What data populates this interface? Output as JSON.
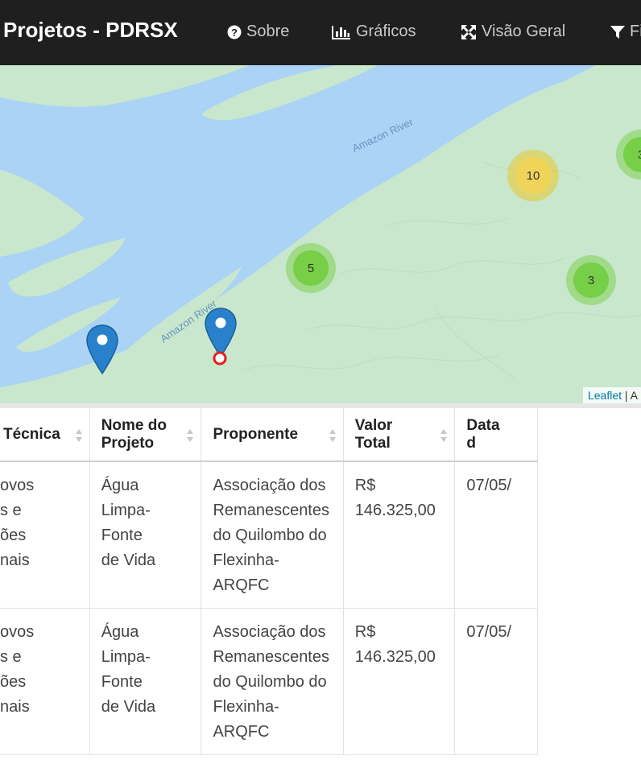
{
  "navbar": {
    "brand": "Projetos - PDRSX",
    "items": [
      {
        "label": "Sobre",
        "icon": "question-circle-icon"
      },
      {
        "label": "Gráficos",
        "icon": "bar-chart-icon"
      },
      {
        "label": "Visão Geral",
        "icon": "expand-arrows-icon"
      },
      {
        "label": "Fi",
        "icon": "filter-icon"
      }
    ]
  },
  "map": {
    "river_labels": [
      "Amazon River",
      "Amazon River"
    ],
    "clusters": [
      {
        "count": "10",
        "color": "yellow"
      },
      {
        "count": "5",
        "color": "green"
      },
      {
        "count": "3",
        "color": "green"
      },
      {
        "count": "3",
        "color": "green"
      }
    ],
    "attribution": {
      "link": "Leaflet",
      "rest": " | A"
    }
  },
  "table": {
    "columns": [
      "Técnica",
      "Nome do Projeto",
      "Proponente",
      "Valor Total",
      "Data d"
    ],
    "rows": [
      {
        "c0": [
          "ovos",
          "s e",
          "ões",
          "nais"
        ],
        "c1": [
          "Água Limpa- Fonte",
          "de Vida"
        ],
        "c2": [
          "Associação dos",
          "Remanescentes",
          "do Quilombo do",
          "Flexinha-",
          "ARQFC"
        ],
        "c3": "R$ 146.325,00",
        "c4": "07/05/"
      },
      {
        "c0": [
          "ovos",
          "s e",
          "ões",
          "nais"
        ],
        "c1": [
          "Água Limpa- Fonte",
          "de Vida"
        ],
        "c2": [
          "Associação dos",
          "Remanescentes",
          "do Quilombo do",
          "Flexinha-",
          "ARQFC"
        ],
        "c3": "R$ 146.325,00",
        "c4": "07/05/"
      }
    ]
  }
}
